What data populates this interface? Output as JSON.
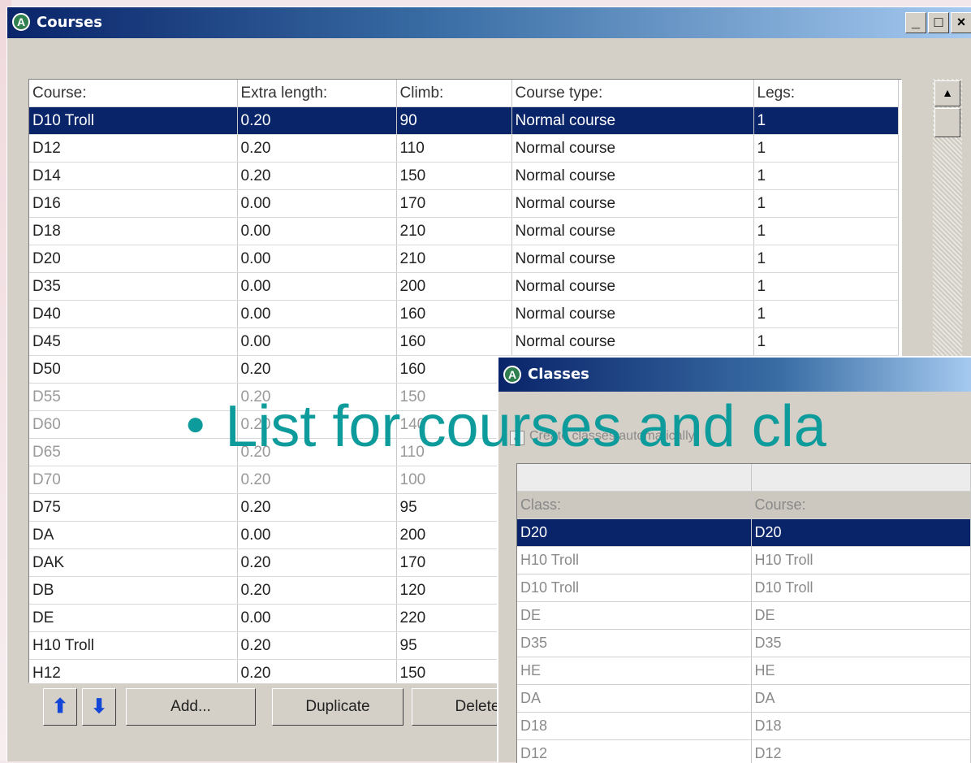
{
  "courses_window": {
    "title": "Courses",
    "window_buttons": [
      "_",
      "□",
      "×"
    ],
    "columns": [
      "Course:",
      "Extra length:",
      "Climb:",
      "Course type:",
      "Legs:"
    ],
    "rows": [
      [
        "D10 Troll",
        "0.20",
        "90",
        "Normal course",
        "1"
      ],
      [
        "D12",
        "0.20",
        "110",
        "Normal course",
        "1"
      ],
      [
        "D14",
        "0.20",
        "150",
        "Normal course",
        "1"
      ],
      [
        "D16",
        "0.00",
        "170",
        "Normal course",
        "1"
      ],
      [
        "D18",
        "0.00",
        "210",
        "Normal course",
        "1"
      ],
      [
        "D20",
        "0.00",
        "210",
        "Normal course",
        "1"
      ],
      [
        "D35",
        "0.00",
        "200",
        "Normal course",
        "1"
      ],
      [
        "D40",
        "0.00",
        "160",
        "Normal course",
        "1"
      ],
      [
        "D45",
        "0.00",
        "160",
        "Normal course",
        "1"
      ],
      [
        "D50",
        "0.20",
        "160",
        "",
        ""
      ],
      [
        "D55",
        "0.20",
        "150",
        "",
        ""
      ],
      [
        "D60",
        "0.20",
        "140",
        "",
        ""
      ],
      [
        "D65",
        "0.20",
        "110",
        "",
        ""
      ],
      [
        "D70",
        "0.20",
        "100",
        "",
        ""
      ],
      [
        "D75",
        "0.20",
        "95",
        "",
        ""
      ],
      [
        "DA",
        "0.00",
        "200",
        "",
        ""
      ],
      [
        "DAK",
        "0.20",
        "170",
        "",
        ""
      ],
      [
        "DB",
        "0.20",
        "120",
        "",
        ""
      ],
      [
        "DE",
        "0.00",
        "220",
        "",
        ""
      ],
      [
        "H10 Troll",
        "0.20",
        "95",
        "",
        ""
      ],
      [
        "H12",
        "0.20",
        "150",
        "",
        ""
      ]
    ],
    "selected_row": 0,
    "buttons": {
      "up": "⬆",
      "down": "⬇",
      "add": "Add...",
      "duplicate": "Duplicate",
      "delete": "Delete"
    }
  },
  "classes_window": {
    "title": "Classes",
    "checkbox_label": "Create classes automatically",
    "columns": [
      "Class:",
      "Course:"
    ],
    "rows": [
      [
        "D20",
        "D20"
      ],
      [
        "H10 Troll",
        "H10 Troll"
      ],
      [
        "D10 Troll",
        "D10 Troll"
      ],
      [
        "DE",
        "DE"
      ],
      [
        "D35",
        "D35"
      ],
      [
        "HE",
        "HE"
      ],
      [
        "DA",
        "DA"
      ],
      [
        "D18",
        "D18"
      ],
      [
        "D12",
        "D12"
      ]
    ],
    "selected_row": 0
  },
  "bullet_text": "List for courses and cla",
  "colors": {
    "selection": "#0a246a",
    "bullet": "#0e9b9b",
    "window_face": "#d4d0c8"
  }
}
